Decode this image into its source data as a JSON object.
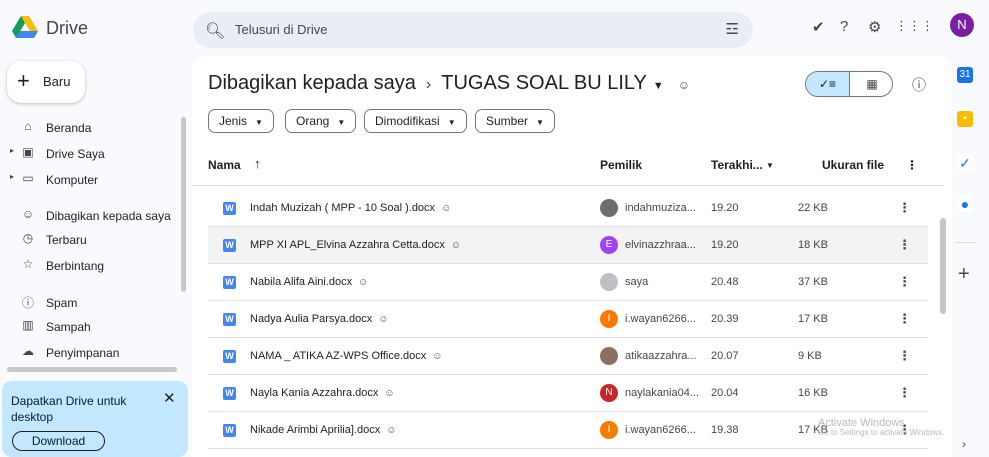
{
  "app": {
    "name": "Drive"
  },
  "search": {
    "placeholder": "Telusuri di Drive"
  },
  "user": {
    "avatar_letter": "N"
  },
  "sidebar": {
    "new_label": "Baru",
    "items": [
      {
        "label": "Beranda",
        "icon": "home-icon"
      },
      {
        "label": "Drive Saya",
        "icon": "my-drive-icon"
      },
      {
        "label": "Komputer",
        "icon": "computer-icon"
      },
      {
        "label": "Dibagikan kepada saya",
        "icon": "shared-icon"
      },
      {
        "label": "Terbaru",
        "icon": "clock-icon"
      },
      {
        "label": "Berbintang",
        "icon": "star-icon"
      },
      {
        "label": "Spam",
        "icon": "spam-icon"
      },
      {
        "label": "Sampah",
        "icon": "trash-icon"
      },
      {
        "label": "Penyimpanan",
        "icon": "cloud-icon"
      }
    ],
    "promo": {
      "text": "Dapatkan Drive untuk desktop",
      "button": "Download"
    }
  },
  "main": {
    "breadcrumb": {
      "parent": "Dibagikan kepada saya",
      "current": "TUGAS SOAL BU LILY"
    },
    "filters": [
      "Jenis",
      "Orang",
      "Dimodifikasi",
      "Sumber"
    ],
    "columns": {
      "name": "Nama",
      "owner": "Pemilik",
      "modified": "Terakhi...",
      "size": "Ukuran file"
    },
    "files": [
      {
        "name": "Indah Muzizah ( MPP - 10 Soal ).docx",
        "owner": "indahmuziza...",
        "modified": "19.20",
        "size": "22 KB",
        "avatar_letter": "",
        "avatar_color": "#6d6d6d"
      },
      {
        "name": "MPP XI APL_Elvina Azzahra Cetta.docx",
        "owner": "elvinazzhraa...",
        "modified": "19.20",
        "size": "18 KB",
        "avatar_letter": "E",
        "avatar_color": "#a142f4"
      },
      {
        "name": "Nabila Alifa Aini.docx",
        "owner": "saya",
        "modified": "20.48",
        "size": "37 KB",
        "avatar_letter": "",
        "avatar_color": "#bdc1c6"
      },
      {
        "name": "Nadya Aulia Parsya.docx",
        "owner": "i.wayan6266...",
        "modified": "20.39",
        "size": "17 KB",
        "avatar_letter": "I",
        "avatar_color": "#f57c00"
      },
      {
        "name": "NAMA _ ATIKA AZ-WPS Office.docx",
        "owner": "atikaazzahra...",
        "modified": "20.07",
        "size": "9 KB",
        "avatar_letter": "",
        "avatar_color": "#8d6e63"
      },
      {
        "name": "Nayla Kania Azzahra.docx",
        "owner": "naylakania04...",
        "modified": "20.04",
        "size": "16 KB",
        "avatar_letter": "N",
        "avatar_color": "#c62828"
      },
      {
        "name": "Nikade Arimbi Aprilia].docx",
        "owner": "i.wayan6266...",
        "modified": "19.38",
        "size": "17 KB",
        "avatar_letter": "I",
        "avatar_color": "#f57c00"
      }
    ]
  },
  "watermark": {
    "line1": "Activate Windows",
    "line2": "Go to Settings to activate Windows."
  }
}
